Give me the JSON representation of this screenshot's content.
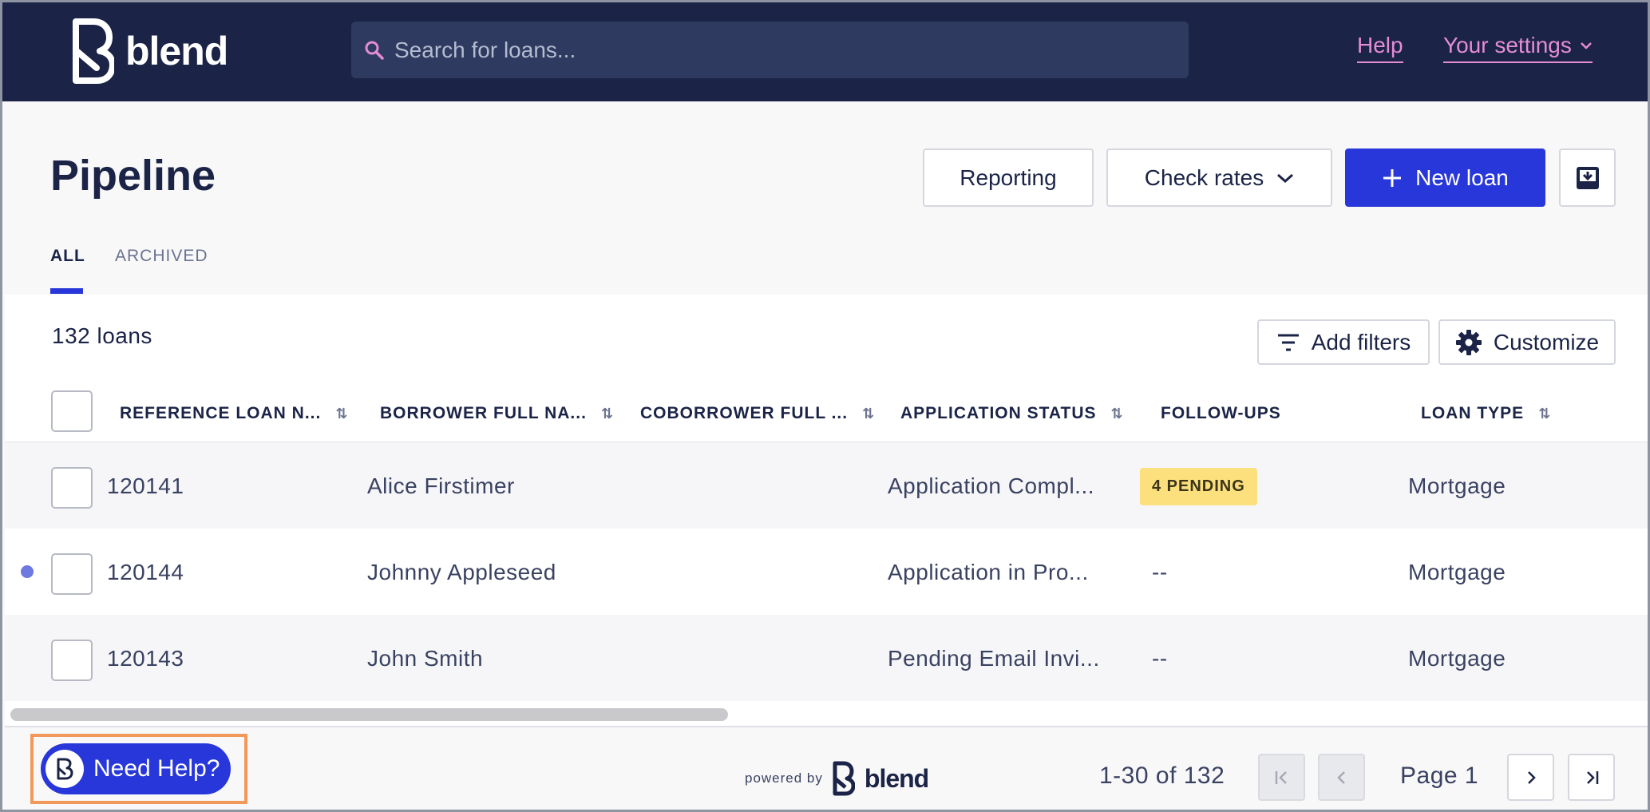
{
  "header": {
    "logo_text": "blend",
    "search_placeholder": "Search for loans...",
    "help_link": "Help",
    "settings_link": "Your settings"
  },
  "page": {
    "title": "Pipeline",
    "reporting_label": "Reporting",
    "check_rates_label": "Check rates",
    "new_loan_label": "New loan",
    "export_icon": "download-inbox-icon"
  },
  "tabs": [
    {
      "label": "ALL",
      "active": true
    },
    {
      "label": "ARCHIVED",
      "active": false
    }
  ],
  "table": {
    "count_label": "132 loans",
    "add_filters_label": "Add filters",
    "customize_label": "Customize",
    "columns": [
      "REFERENCE LOAN N...",
      "BORROWER FULL NA...",
      "COBORROWER FULL ...",
      "APPLICATION STATUS",
      "FOLLOW-UPS",
      "LOAN TYPE"
    ],
    "rows": [
      {
        "ref": "120141",
        "borrower": "Alice Firstimer",
        "coborrower": "",
        "status": "Application Compl...",
        "followups": "4 PENDING",
        "loan_type": "Mortgage",
        "unread": false
      },
      {
        "ref": "120144",
        "borrower": "Johnny Appleseed",
        "coborrower": "",
        "status": "Application in Pro...",
        "followups": "--",
        "loan_type": "Mortgage",
        "unread": true
      },
      {
        "ref": "120143",
        "borrower": "John Smith",
        "coborrower": "",
        "status": "Pending Email Invi...",
        "followups": "--",
        "loan_type": "Mortgage",
        "unread": false
      }
    ]
  },
  "footer": {
    "need_help_label": "Need Help?",
    "powered_by": "powered by",
    "powered_brand": "blend",
    "range_label": "1-30 of 132",
    "page_label": "Page 1"
  },
  "colors": {
    "navy": "#1b2447",
    "primary": "#2837d9",
    "link_pink": "#e58cd6",
    "badge_yellow": "#fbe07d",
    "highlight_orange": "#f0995a"
  }
}
